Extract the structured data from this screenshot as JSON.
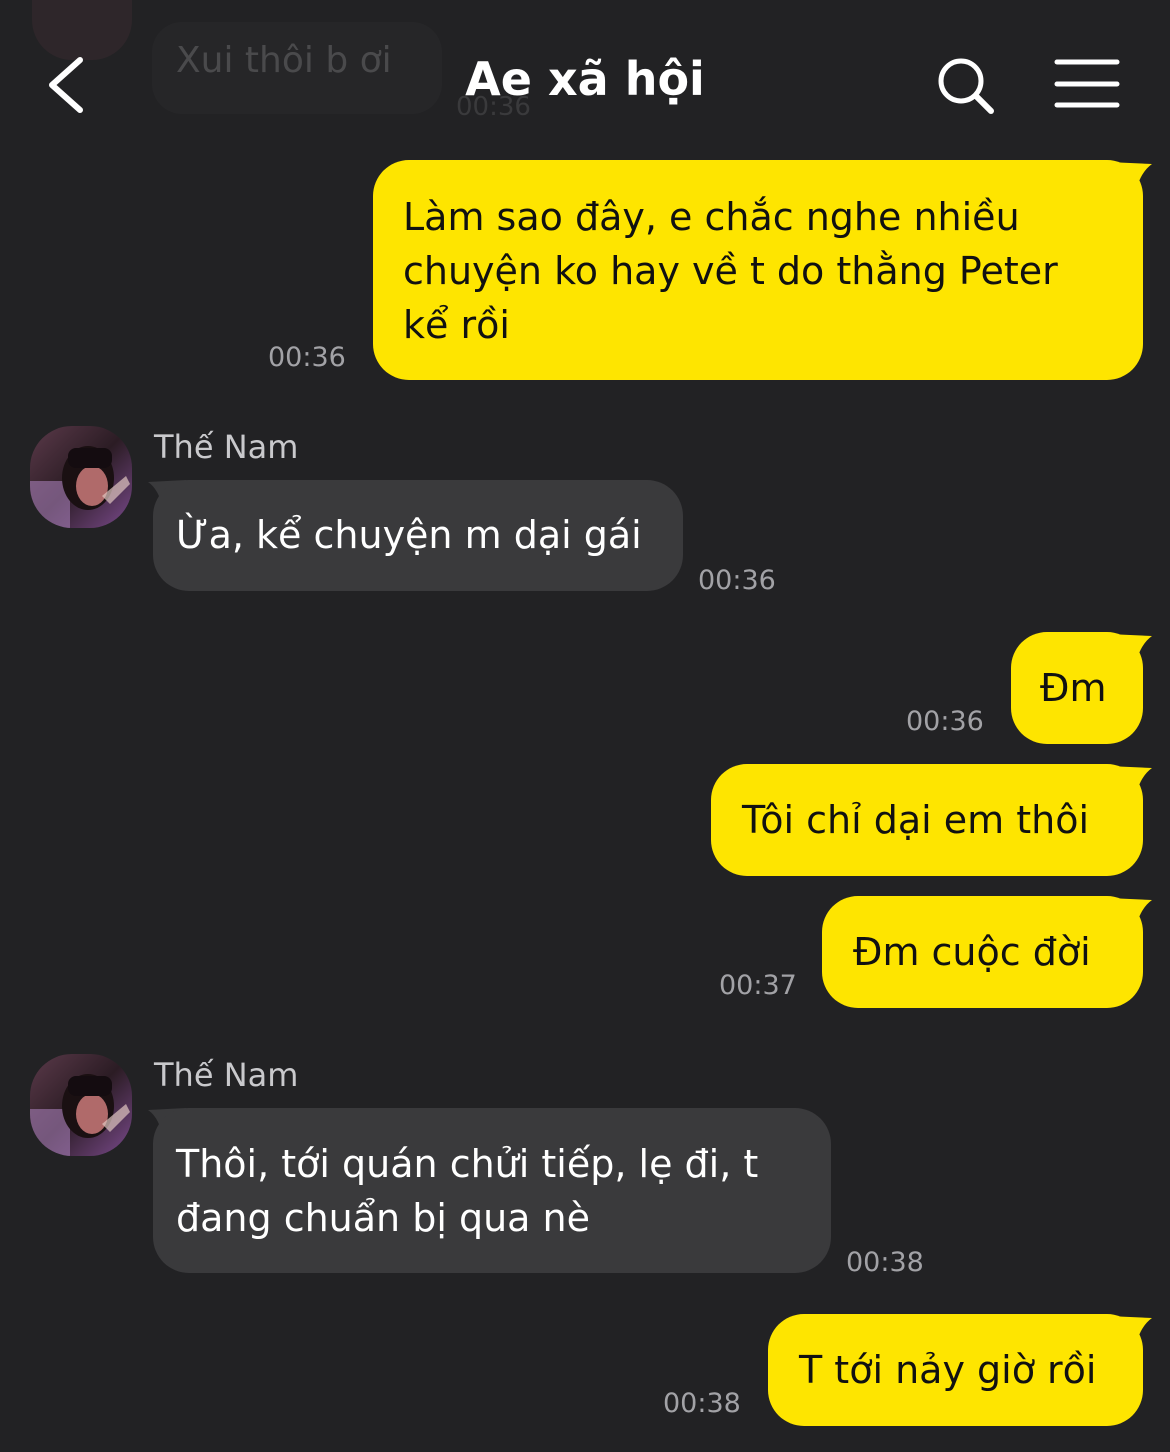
{
  "header": {
    "title": "Ae xã hội",
    "back_icon": "chevron-left-icon",
    "search_icon": "search-icon",
    "menu_icon": "hamburger-menu-icon"
  },
  "previous_message": {
    "text": "Xui thôi b ơi",
    "time": "00:36"
  },
  "colors": {
    "background": "#222224",
    "outgoing_bubble": "#fee500",
    "incoming_bubble": "#3a3a3c",
    "timestamp": "#a2a2a6"
  },
  "messages": [
    {
      "direction": "out",
      "lines": [
        "Làm sao đây, e chắc nghe nhiều",
        "chuyện ko hay về t do thằng Peter",
        "kể rồi"
      ],
      "time": "00:36"
    },
    {
      "direction": "in",
      "sender": "Thế Nam",
      "lines": [
        "Ừa, kể chuyện m dại gái"
      ],
      "time": "00:36"
    },
    {
      "direction": "out",
      "lines": [
        "Đm"
      ],
      "time": "00:36"
    },
    {
      "direction": "out",
      "lines": [
        "Tôi chỉ dại em thôi"
      ]
    },
    {
      "direction": "out",
      "lines": [
        "Đm cuộc đời"
      ],
      "time": "00:37"
    },
    {
      "direction": "in",
      "sender": "Thế Nam",
      "lines": [
        "Thôi, tới quán chửi tiếp, lẹ đi, t",
        "đang chuẩn bị qua nè"
      ],
      "time": "00:38"
    },
    {
      "direction": "out",
      "lines": [
        "T tới nảy giờ rồi"
      ],
      "time": "00:38"
    }
  ]
}
